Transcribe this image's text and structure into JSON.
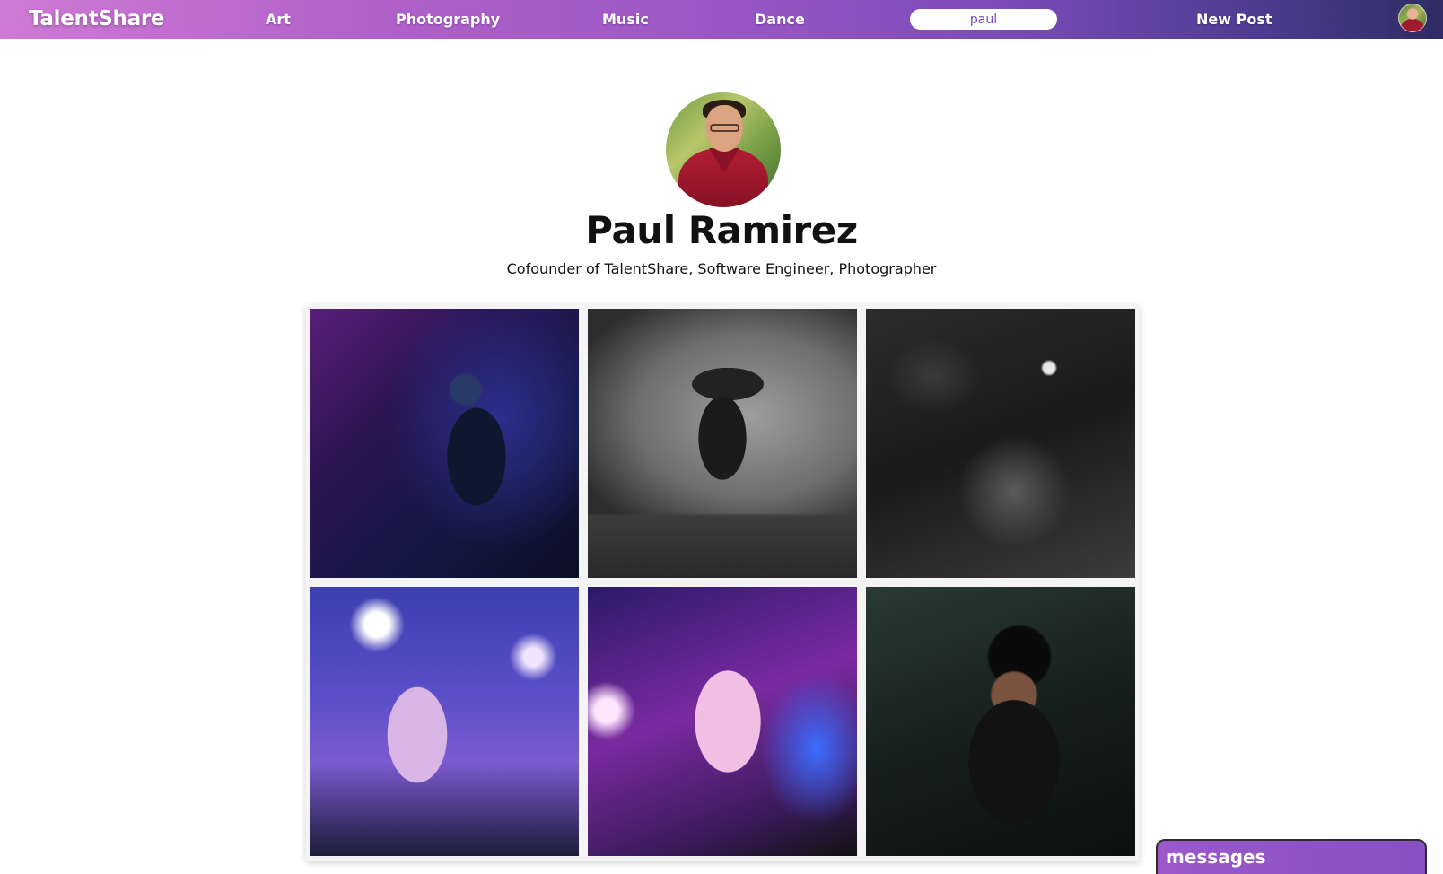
{
  "app": {
    "name": "TalentShare",
    "brand_gradient": [
      "#cf7ad6",
      "#9a57c4",
      "#2e2c63"
    ]
  },
  "navbar": {
    "logo": "TalentShare",
    "items": [
      {
        "label": "Art"
      },
      {
        "label": "Photography"
      },
      {
        "label": "Music"
      },
      {
        "label": "Dance"
      }
    ],
    "search": {
      "value": "paul",
      "placeholder": ""
    },
    "new_post_label": "New Post",
    "avatar_icon": "user-avatar-icon"
  },
  "profile": {
    "name": "Paul Ramirez",
    "bio": "Cofounder of TalentShare, Software Engineer, Photographer"
  },
  "gallery": {
    "photos": [
      {
        "description_icon": "concert-photo-icon"
      },
      {
        "description_icon": "concert-photo-icon"
      },
      {
        "description_icon": "concert-photo-icon"
      },
      {
        "description_icon": "concert-photo-icon"
      },
      {
        "description_icon": "concert-photo-icon"
      },
      {
        "description_icon": "concert-photo-icon"
      }
    ]
  },
  "messages": {
    "label": "messages"
  }
}
